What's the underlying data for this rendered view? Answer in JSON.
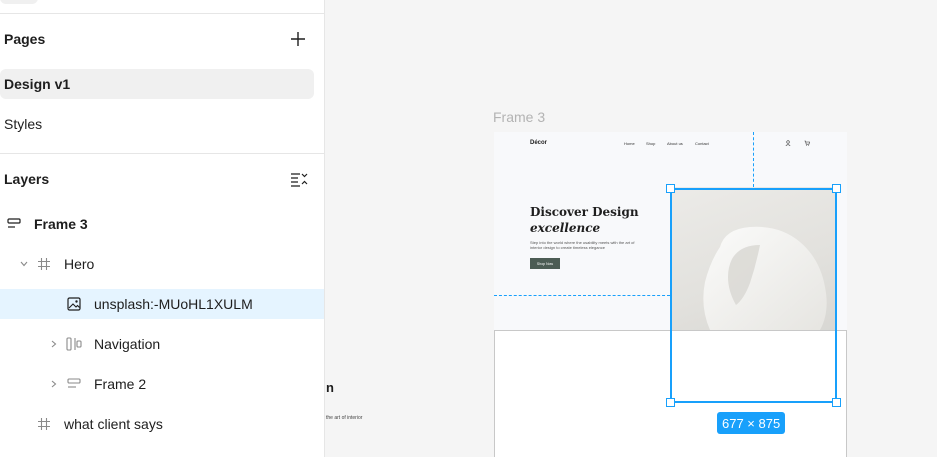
{
  "sidebar": {
    "pages_title": "Pages",
    "pages": [
      {
        "label": "Design v1",
        "active": true
      },
      {
        "label": "Styles",
        "active": false
      }
    ],
    "layers_title": "Layers",
    "layers": [
      {
        "label": "Frame 3",
        "icon": "frame-icon"
      },
      {
        "label": "Hero",
        "icon": "hash-icon"
      },
      {
        "label": "unsplash:-MUoHL1XULM",
        "icon": "image-icon"
      },
      {
        "label": "Navigation",
        "icon": "columns-icon"
      },
      {
        "label": "Frame 2",
        "icon": "rows-icon"
      },
      {
        "label": "what client says",
        "icon": "hash-icon"
      }
    ]
  },
  "canvas": {
    "frame_label": "Frame 3",
    "nav": {
      "logo": "Décor",
      "links": [
        "Home",
        "Shop",
        "About us",
        "Contact"
      ]
    },
    "hero": {
      "title_line1": "Discover Design",
      "title_line2": "excellence",
      "description": "Step into the world where the usability meets with the art of interior design to create timeless elegance",
      "button": "Shop Now"
    },
    "dimension_badge": "677 × 875",
    "peek_heading": "n",
    "peek_text": "the art of interior"
  },
  "colors": {
    "accent": "#18a0fb",
    "selected_row": "#e5f4ff",
    "button": "#4c5c54"
  }
}
